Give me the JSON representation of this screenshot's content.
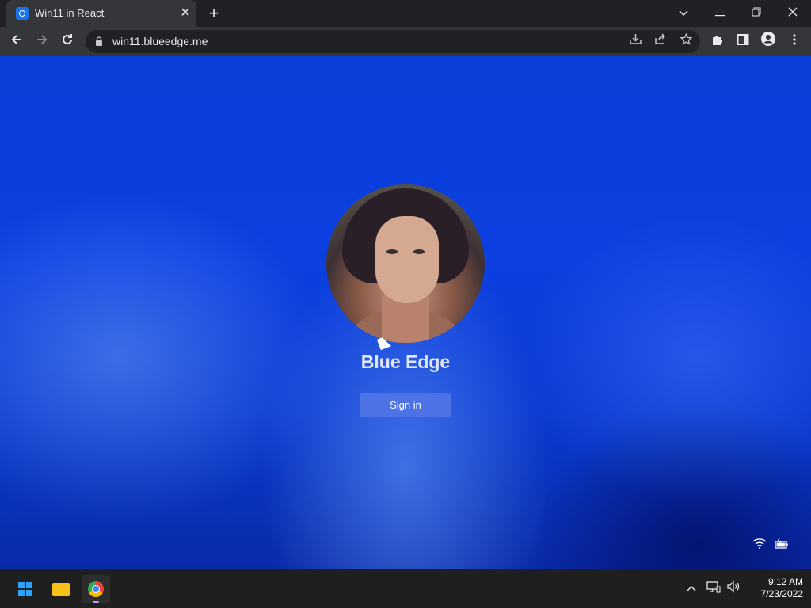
{
  "browser": {
    "tab_title": "Win11 in React",
    "tab_close": "✕",
    "new_tab": "+",
    "url": "win11.blueedge.me"
  },
  "login": {
    "username": "Blue Edge",
    "signin_label": "Sign in"
  },
  "taskbar": {
    "time": "9:12 AM",
    "date": "7/23/2022"
  }
}
